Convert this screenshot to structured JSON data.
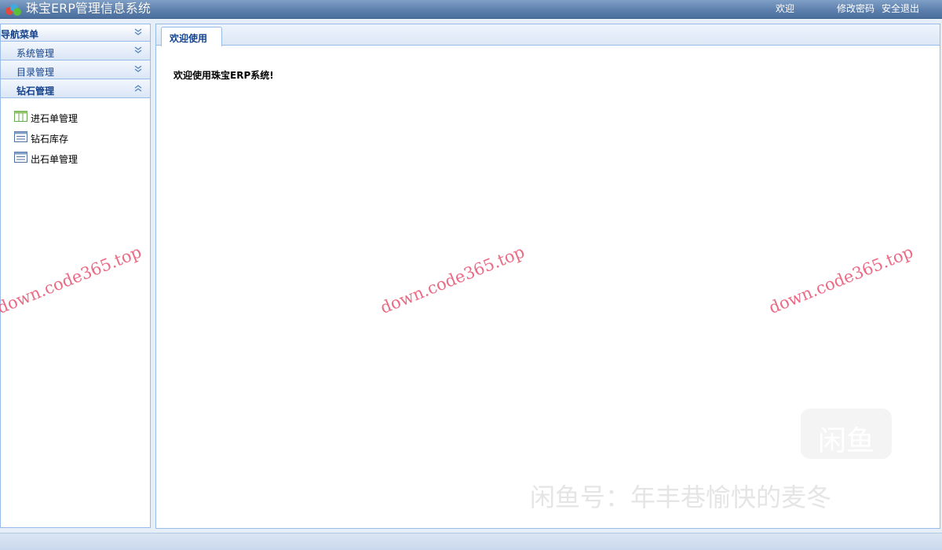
{
  "header": {
    "title": "珠宝ERP管理信息系统",
    "welcome": "欢迎",
    "change_password": "修改密码",
    "logout": "安全退出"
  },
  "sidebar": {
    "title": "导航菜单",
    "sections": [
      {
        "label": "系统管理",
        "state": "collapsed"
      },
      {
        "label": "目录管理",
        "state": "collapsed"
      },
      {
        "label": "钻石管理",
        "state": "expanded"
      }
    ],
    "items": [
      {
        "label": "进石单管理",
        "icon": "table-icon"
      },
      {
        "label": "钻石库存",
        "icon": "form-icon"
      },
      {
        "label": "出石单管理",
        "icon": "form-icon"
      }
    ]
  },
  "main": {
    "tab": "欢迎使用",
    "welcome_text": "欢迎使用珠宝ERP系统!"
  },
  "watermarks": {
    "site": "down.code365.top",
    "xianyu_logo": "闲鱼",
    "xianyu_text": "闲鱼号：年丰巷愉快的麦冬"
  },
  "colors": {
    "header": "#5d80ad",
    "border": "#99bbe8",
    "panel_title": "#15428b",
    "watermark": "#e8506e"
  }
}
